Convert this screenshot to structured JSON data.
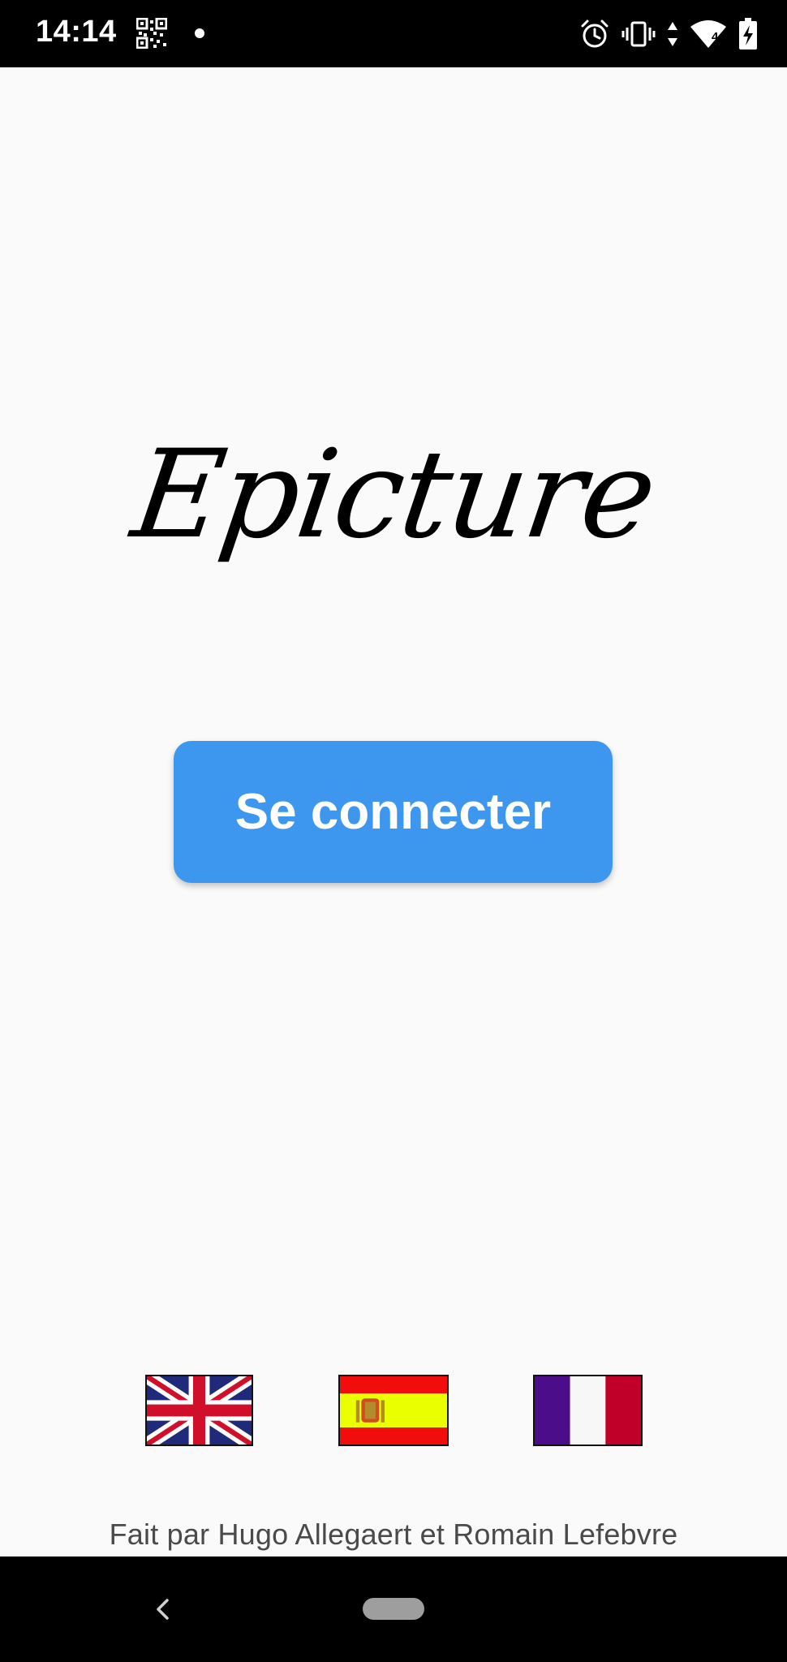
{
  "status_bar": {
    "time": "14:14",
    "icons": [
      "qr-code-icon",
      "notification-dot-icon",
      "alarm-icon",
      "vibrate-icon",
      "data-arrows-icon",
      "wifi-icon",
      "battery-charging-icon"
    ],
    "signal_badge": "4"
  },
  "app": {
    "logo_text": "Epicture",
    "connect_button_label": "Se connecter",
    "button_color": "#3d97ef",
    "languages": [
      {
        "code": "en",
        "icon": "uk-flag-icon"
      },
      {
        "code": "es",
        "icon": "spain-flag-icon"
      },
      {
        "code": "fr",
        "icon": "france-flag-icon"
      }
    ],
    "footer_credit": "Fait par Hugo Allegaert et Romain Lefebvre"
  },
  "nav_bar": {
    "icons": [
      "back-icon",
      "home-pill-icon"
    ]
  }
}
